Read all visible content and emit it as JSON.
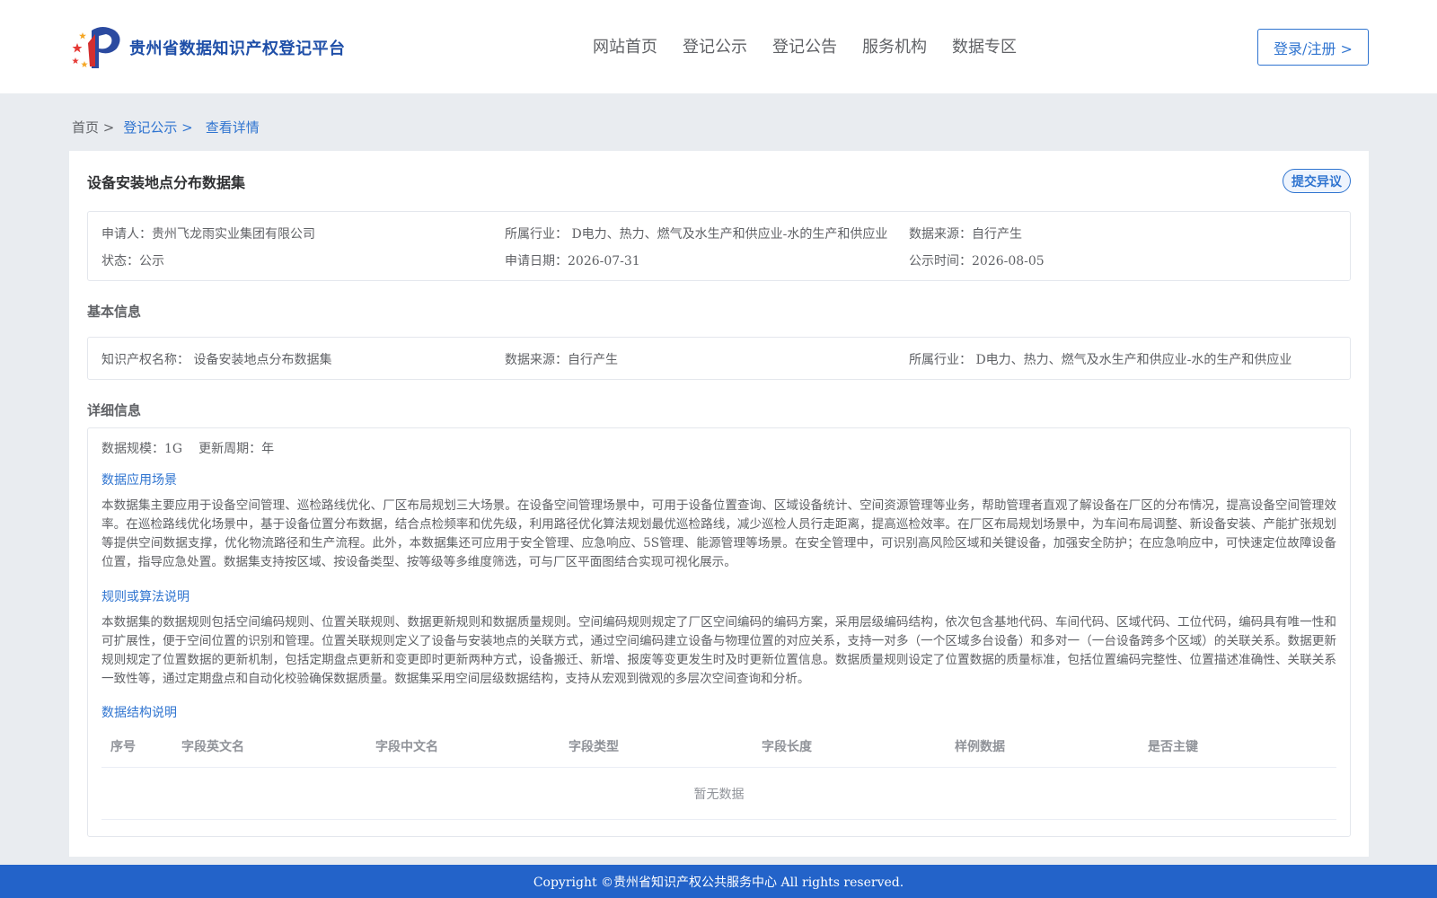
{
  "brand": {
    "title": "贵州省数据知识产权登记平台",
    "logo_icon": "platform-logo-icon"
  },
  "nav": {
    "items": [
      "网站首页",
      "登记公示",
      "登记公告",
      "服务机构",
      "数据专区"
    ]
  },
  "login": {
    "label": "登录/注册 >"
  },
  "breadcrumb": {
    "home": "首页 >",
    "level2": "登记公示 >",
    "current": "查看详情"
  },
  "page": {
    "title": "设备安装地点分布数据集",
    "objection_label": "提交异议"
  },
  "summary": {
    "applicant": "申请人：贵州飞龙雨实业集团有限公司",
    "industry": "所属行业： D电力、热力、燃气及水生产和供应业-水的生产和供应业",
    "source": "数据来源：自行产生",
    "status": "状态：公示",
    "apply_date": "申请日期：2026-07-31",
    "publish_date": "公示时间：2026-08-05"
  },
  "basic": {
    "title": "基本信息",
    "ip_name": "知识产权名称： 设备安装地点分布数据集",
    "source": "数据来源：自行产生",
    "industry": "所属行业： D电力、热力、燃气及水生产和供应业-水的生产和供应业"
  },
  "detail": {
    "title": "详细信息",
    "scale": "数据规模：1G",
    "period": "更新周期：年",
    "scenario_title": "数据应用场景",
    "scenario_text": "本数据集主要应用于设备空间管理、巡检路线优化、厂区布局规划三大场景。在设备空间管理场景中，可用于设备位置查询、区域设备统计、空间资源管理等业务，帮助管理者直观了解设备在厂区的分布情况，提高设备空间管理效率。在巡检路线优化场景中，基于设备位置分布数据，结合点检频率和优先级，利用路径优化算法规划最优巡检路线，减少巡检人员行走距离，提高巡检效率。在厂区布局规划场景中，为车间布局调整、新设备安装、产能扩张规划等提供空间数据支撑，优化物流路径和生产流程。此外，本数据集还可应用于安全管理、应急响应、5S管理、能源管理等场景。在安全管理中，可识别高风险区域和关键设备，加强安全防护；在应急响应中，可快速定位故障设备位置，指导应急处置。数据集支持按区域、按设备类型、按等级等多维度筛选，可与厂区平面图结合实现可视化展示。",
    "rules_title": "规则或算法说明",
    "rules_text": "本数据集的数据规则包括空间编码规则、位置关联规则、数据更新规则和数据质量规则。空间编码规则规定了厂区空间编码的编码方案，采用层级编码结构，依次包含基地代码、车间代码、区域代码、工位代码，编码具有唯一性和可扩展性，便于空间位置的识别和管理。位置关联规则定义了设备与安装地点的关联方式，通过空间编码建立设备与物理位置的对应关系，支持一对多（一个区域多台设备）和多对一（一台设备跨多个区域）的关联关系。数据更新规则规定了位置数据的更新机制，包括定期盘点更新和变更即时更新两种方式，设备搬迁、新增、报废等变更发生时及时更新位置信息。数据质量规则设定了位置数据的质量标准，包括位置编码完整性、位置描述准确性、关联关系一致性等，通过定期盘点和自动化校验确保数据质量。数据集采用空间层级数据结构，支持从宏观到微观的多层次空间查询和分析。",
    "structure_title": "数据结构说明",
    "table": {
      "headers": [
        "序号",
        "字段英文名",
        "字段中文名",
        "字段类型",
        "字段长度",
        "样例数据",
        "是否主键"
      ],
      "empty_text": "暂无数据"
    }
  },
  "footer": {
    "text": "Copyright ©贵州省知识产权公共服务中心 All rights reserved."
  },
  "colors": {
    "accent": "#2f74d0",
    "footer_bg": "#2363c9",
    "brand_text": "#1f4fa8",
    "page_bg": "#e9ecf0"
  }
}
